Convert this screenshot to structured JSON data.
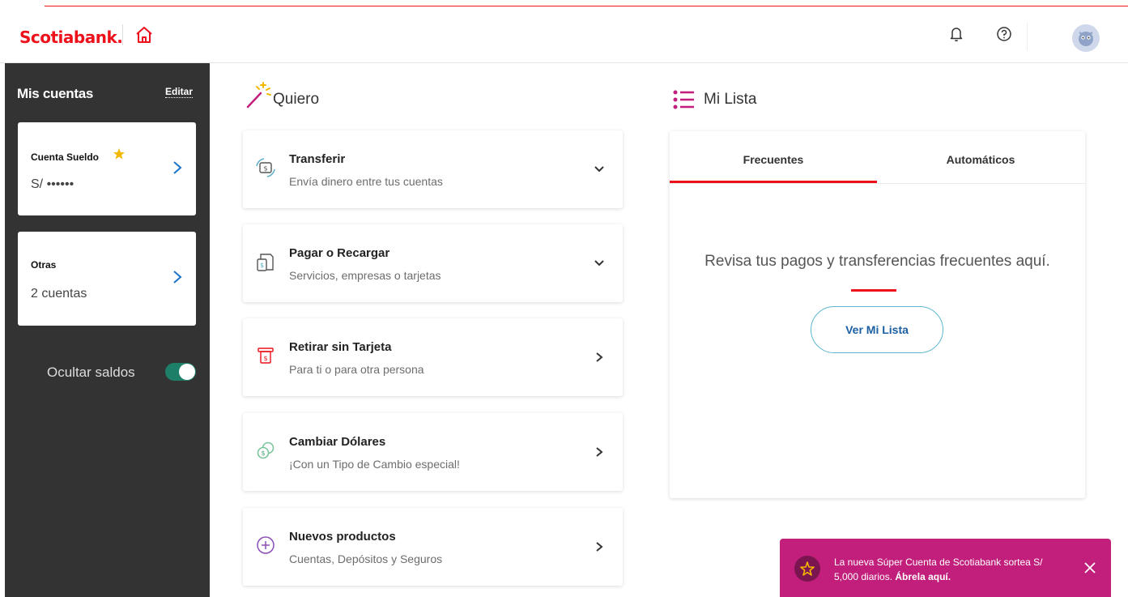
{
  "header": {
    "logo_text": "Scotiabank."
  },
  "sidebar": {
    "title": "Mis cuentas",
    "edit_label": "Editar",
    "accounts": [
      {
        "name": "Cuenta Sueldo",
        "value": "S/ ••••••"
      },
      {
        "name": "Otras",
        "value": "2 cuentas"
      }
    ],
    "hide_balances_label": "Ocultar saldos"
  },
  "quiero": {
    "title": "Quiero",
    "actions": [
      {
        "title": "Transferir",
        "subtitle": "Envía dinero entre tus cuentas"
      },
      {
        "title": "Pagar o Recargar",
        "subtitle": "Servicios, empresas o tarjetas"
      },
      {
        "title": "Retirar sin Tarjeta",
        "subtitle": "Para ti o para otra persona"
      },
      {
        "title": "Cambiar Dólares",
        "subtitle": "¡Con un Tipo de Cambio especial!"
      },
      {
        "title": "Nuevos productos",
        "subtitle": "Cuentas, Depósitos y Seguros"
      }
    ]
  },
  "mi_lista": {
    "title": "Mi Lista",
    "tabs": [
      {
        "label": "Frecuentes"
      },
      {
        "label": "Automáticos"
      }
    ],
    "empty_message": "Revisa tus pagos y transferencias frecuentes aquí.",
    "button_label": "Ver Mi Lista"
  },
  "promo": {
    "text": "La nueva Súper Cuenta de Scotiabank sortea S/ 5,000 diarios.",
    "link_text": "Ábrela aquí."
  },
  "colors": {
    "brand_red": "#ec111a",
    "sidebar_bg": "#333333",
    "toggle_on": "#1e7f69",
    "promo_bg": "#c11f7b",
    "button_border": "#5fb8cf",
    "star": "#f5b800"
  },
  "icons": {
    "home": "home-icon",
    "notifications": "bell-icon",
    "help": "help-icon",
    "account_favorite": "star-icon",
    "quiero": "magic-wand-icon",
    "mi_lista": "list-icon",
    "transferir": "transfer-icon",
    "pagar": "pay-icon",
    "retirar": "atm-icon",
    "cambiar": "exchange-icon",
    "nuevos": "plus-circle-icon",
    "close": "close-icon"
  },
  "toggle": {
    "hide_balances": true
  }
}
